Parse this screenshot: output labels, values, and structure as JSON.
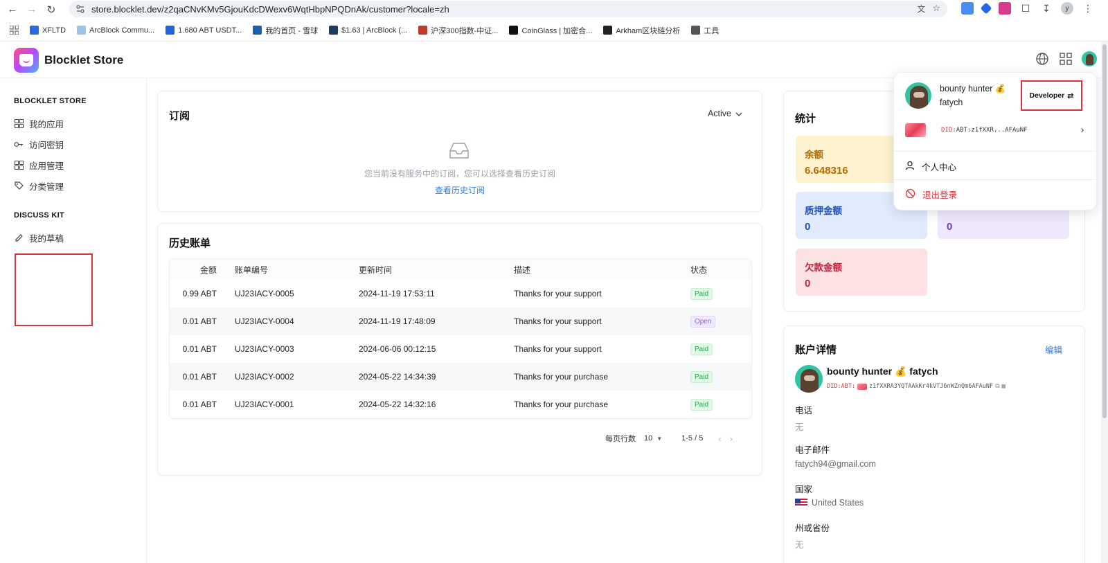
{
  "browser": {
    "url": "store.blocklet.dev/z2qaCNvKMv5GjouKdcDWexv6WqtHbpNPQDnAk/customer?locale=zh",
    "avatar_letter": "y",
    "bookmarks": [
      {
        "label": "XFLTD",
        "color": "#2a6ae6"
      },
      {
        "label": "ArcBlock Commu...",
        "color": "#9fc3e8"
      },
      {
        "label": "1.680 ABT USDT...",
        "color": "#1e66e0"
      },
      {
        "label": "我的首页 - 雪球",
        "color": "#1a5fb4"
      },
      {
        "label": "$1.63 | ArcBlock (...",
        "color": "#1d3a64"
      },
      {
        "label": "沪深300指数-中证...",
        "color": "#c0392b"
      },
      {
        "label": "CoinGlass | 加密合...",
        "color": "#111111"
      },
      {
        "label": "Arkham区块链分析",
        "color": "#222222"
      },
      {
        "label": "工具",
        "color": "#555555"
      }
    ]
  },
  "header": {
    "title": "Blocklet Store"
  },
  "sidebar": {
    "section1": "BLOCKLET STORE",
    "items1": [
      {
        "label": "我的应用",
        "icon": "grid-icon"
      },
      {
        "label": "访问密钥",
        "icon": "key-icon"
      },
      {
        "label": "应用管理",
        "icon": "grid-icon"
      },
      {
        "label": "分类管理",
        "icon": "tag-icon"
      }
    ],
    "section2": "DISCUSS KIT",
    "items2": [
      {
        "label": "我的草稿",
        "icon": "edit-icon"
      }
    ]
  },
  "subscriptions": {
    "title": "订阅",
    "filter": "Active",
    "empty_text": "您当前没有服务中的订阅，您可以选择查看历史订阅",
    "history_link": "查看历史订阅"
  },
  "invoices": {
    "title": "历史账单",
    "columns": [
      "金额",
      "账单编号",
      "更新时间",
      "描述",
      "状态"
    ],
    "rows": [
      {
        "amount": "0.99 ABT",
        "number": "UJ23IACY-0005",
        "time": "2024-11-19 17:53:11",
        "desc": "Thanks for your support",
        "status": "Paid"
      },
      {
        "amount": "0.01 ABT",
        "number": "UJ23IACY-0004",
        "time": "2024-11-19 17:48:09",
        "desc": "Thanks for your support",
        "status": "Open"
      },
      {
        "amount": "0.01 ABT",
        "number": "UJ23IACY-0003",
        "time": "2024-06-06 00:12:15",
        "desc": "Thanks for your support",
        "status": "Paid"
      },
      {
        "amount": "0.01 ABT",
        "number": "UJ23IACY-0002",
        "time": "2024-05-22 14:34:39",
        "desc": "Thanks for your purchase",
        "status": "Paid"
      },
      {
        "amount": "0.01 ABT",
        "number": "UJ23IACY-0001",
        "time": "2024-05-22 14:32:16",
        "desc": "Thanks for your purchase",
        "status": "Paid"
      }
    ],
    "pager": {
      "rows_label": "每页行数",
      "rows_value": "10",
      "range": "1-5 / 5"
    }
  },
  "stats": {
    "title": "统计",
    "balance_label": "余额",
    "balance_value": "6.648316",
    "stake_label": "质押金额",
    "stake_value": "0",
    "other_value": "0",
    "debt_label": "欠款金额",
    "debt_value": "0"
  },
  "account": {
    "title": "账户详情",
    "edit": "编辑",
    "name": "bounty hunter 💰 fatych",
    "did_prefix": "DID:ABT:",
    "did": "z1fXXRA3YQTAAkKr4kVTJ6nWZnQm6AFAuNF",
    "phone_label": "电话",
    "phone_value": "无",
    "email_label": "电子邮件",
    "email_value": "fatych94@gmail.com",
    "country_label": "国家",
    "country_value": "United States",
    "state_label": "州或省份",
    "state_value": "无"
  },
  "dropdown": {
    "name": "bounty hunter 💰",
    "username": "fatych",
    "role_button": "Developer",
    "did_prefix": "DID:",
    "did_short": "ABT:z1fXXR...AFAuNF",
    "profile": "个人中心",
    "logout": "退出登录"
  },
  "colors": {
    "balance_bg": "#fdf3cf",
    "balance_fg": "#b36b00",
    "stake_bg": "#e1ebfd",
    "stake_fg": "#1f4fb8",
    "other_bg": "#efe8fd",
    "other_fg": "#6a3dc8",
    "debt_bg": "#fde2e4",
    "debt_fg": "#c4213a",
    "link": "#2b7de9",
    "logout": "#d9333f"
  }
}
